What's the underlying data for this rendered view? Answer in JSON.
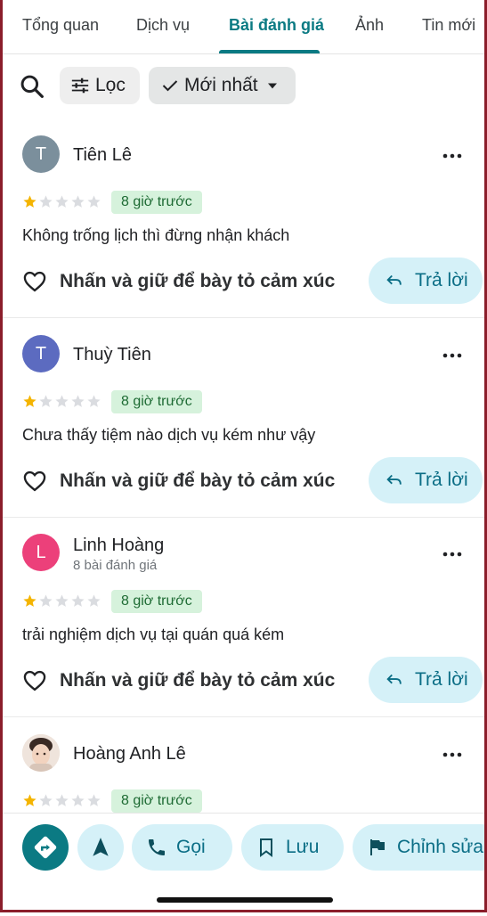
{
  "tabs": [
    {
      "label": "Tổng quan"
    },
    {
      "label": "Dịch vụ"
    },
    {
      "label": "Bài đánh giá"
    },
    {
      "label": "Ảnh"
    },
    {
      "label": "Tin mới"
    }
  ],
  "active_tab": "Bài đánh giá",
  "filters": {
    "search_icon": "search-icon",
    "filter_label": "Lọc",
    "sort_label": "Mới nhất"
  },
  "reviews": [
    {
      "author": "Tiên Lê",
      "initial": "T",
      "avatar_color": "#7b8f9c",
      "sub": "",
      "rating": 1,
      "time": "8 giờ trước",
      "text": "Không trống lịch thì đừng nhận khách",
      "react_label": "Nhấn và giữ để bày tỏ cảm xúc",
      "reply_label": "Trả lời"
    },
    {
      "author": "Thuỳ Tiên",
      "initial": "T",
      "avatar_color": "#5c6bc0",
      "sub": "",
      "rating": 1,
      "time": "8 giờ trước",
      "text": "Chưa thấy tiệm nào dịch vụ kém như vậy",
      "react_label": "Nhấn và giữ để bày tỏ cảm xúc",
      "reply_label": "Trả lời"
    },
    {
      "author": "Linh Hoàng",
      "initial": "L",
      "avatar_color": "#ec407a",
      "sub": "8 bài đánh giá",
      "rating": 1,
      "time": "8 giờ trước",
      "text": "trải nghiệm dịch vụ tại quán quá kém",
      "react_label": "Nhấn và giữ để bày tỏ cảm xúc",
      "reply_label": "Trả lời"
    },
    {
      "author": "Hoàng Anh Lê",
      "initial": "",
      "avatar_color": "#e8d9cf",
      "sub": "",
      "rating": 1,
      "time": "8 giờ trước",
      "text": "",
      "react_label": "",
      "reply_label": ""
    }
  ],
  "bottom_bar": {
    "call_label": "Gọi",
    "save_label": "Lưu",
    "edit_label": "Chỉnh sửa"
  },
  "colors": {
    "accent": "#0b7a83",
    "star_filled": "#f4b400",
    "star_empty": "#dadce0",
    "badge_bg": "#d6f2dc",
    "pill_bg": "#d5f1f8"
  }
}
